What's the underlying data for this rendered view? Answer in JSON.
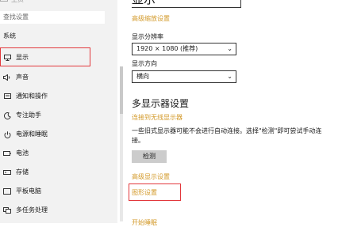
{
  "sidebar": {
    "top_partial_label": "主页",
    "search_placeholder": "查找设置",
    "section_label": "系统",
    "items": [
      {
        "label": "显示",
        "icon": "monitor-icon"
      },
      {
        "label": "声音",
        "icon": "speaker-icon"
      },
      {
        "label": "通知和操作",
        "icon": "notification-icon"
      },
      {
        "label": "专注助手",
        "icon": "moon-icon"
      },
      {
        "label": "电源和睡眠",
        "icon": "power-icon"
      },
      {
        "label": "电池",
        "icon": "battery-icon"
      },
      {
        "label": "存储",
        "icon": "storage-icon"
      },
      {
        "label": "平板电脑",
        "icon": "tablet-icon"
      },
      {
        "label": "多任务处理",
        "icon": "multitask-icon"
      }
    ]
  },
  "main": {
    "heading_partial": "显示",
    "advanced_scaling_link": "高级缩放设置",
    "resolution_label": "显示分辨率",
    "resolution_value": "1920 × 1080 (推荐)",
    "orientation_label": "显示方向",
    "orientation_value": "横向",
    "multi_display_heading": "多显示器设置",
    "wireless_link": "连接到无线显示器",
    "older_displays_desc": "一些旧式显示器可能不会进行自动连接。选择\"检测\"即可尝试手动连接。",
    "detect_button": "检测",
    "advanced_display_link": "高级显示设置",
    "graphics_link": "图形设置",
    "bottom_partial_link": "开始睡眠"
  },
  "colors": {
    "accent_link": "#d39a2a",
    "highlight_box": "#e2383c"
  }
}
